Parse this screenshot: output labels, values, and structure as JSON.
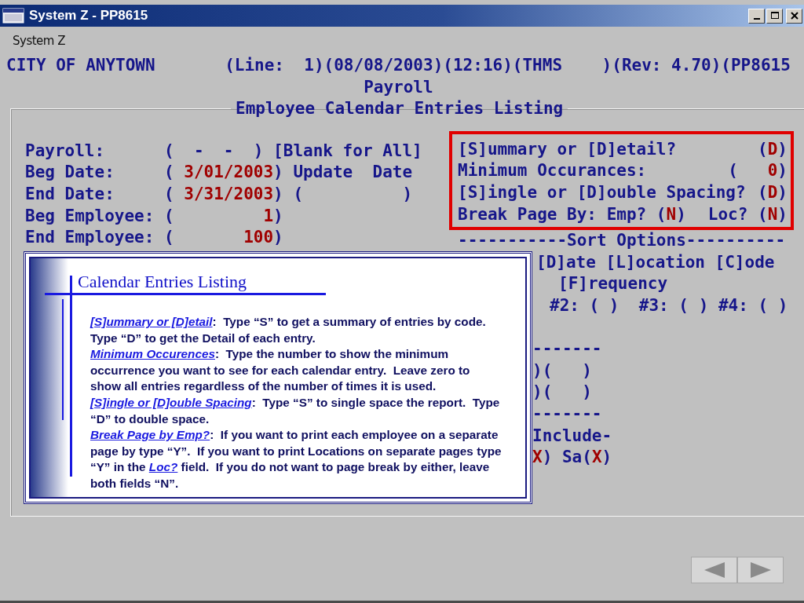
{
  "window": {
    "title": "System Z - PP8615"
  },
  "menu": [
    {
      "label": "System Z"
    }
  ],
  "header": {
    "org": "CITY OF ANYTOWN",
    "session": "(Line:  1)(08/08/2003)(12:16)(THMS    )(Rev: 4.70)(PP8615",
    "module": "Payroll"
  },
  "group": {
    "title": "Employee Calendar Entries Listing",
    "left_fields": [
      {
        "label": "Payroll:",
        "field": {
          "open": "(",
          "close": ")",
          "value": "-  -",
          "kind": "mask"
        },
        "note": {
          "kind": "text",
          "text": "[Blank for All]"
        }
      },
      {
        "label": "Beg Date:",
        "field": {
          "open": "(",
          "close": ")",
          "value": "3/01/2003",
          "kind": "value"
        },
        "note": {
          "kind": "text",
          "text": "Update  Date"
        }
      },
      {
        "label": "End Date:",
        "field": {
          "open": "(",
          "close": ")",
          "value": "3/31/2003",
          "kind": "value"
        },
        "note": {
          "kind": "field",
          "open": "(",
          "close": ")"
        }
      },
      {
        "label": "Beg Employee:",
        "field": {
          "open": "(",
          "close": ")",
          "value": "1",
          "kind": "value"
        }
      },
      {
        "label": "End Employee:",
        "field": {
          "open": "(",
          "close": ")",
          "value": "100",
          "kind": "value"
        }
      }
    ],
    "options": [
      {
        "label": "[S]ummary or [D]etail?",
        "field": {
          "open": "(",
          "close": ")",
          "value": "D",
          "kind": "value"
        }
      },
      {
        "label": "Minimum Occurances:",
        "field": {
          "open": "(",
          "close": ")",
          "value": "0",
          "kind": "number"
        }
      },
      {
        "label": "[S]ingle or [D]ouble Spacing?",
        "field": {
          "open": "(",
          "close": ")",
          "value": "D",
          "kind": "value"
        }
      },
      {
        "label": "Break Page By: Emp?",
        "field": {
          "open": "(",
          "close": ")",
          "value": "N",
          "kind": "value"
        },
        "label2": "Loc?",
        "field2": {
          "open": "(",
          "close": ")",
          "value": "N",
          "kind": "value"
        }
      }
    ],
    "sort": {
      "title": "-----------Sort Options----------",
      "lines": [
        {
          "kind": "choices",
          "text": "[D]ate [L]ocation [C]ode"
        },
        {
          "kind": "continued",
          "text": "[F]requency"
        },
        {
          "kind": "keys",
          "text": "#2: ( )  #3: ( ) #4: ( )"
        }
      ]
    },
    "fragments": [
      {
        "parts": [
          {
            "text": "-------",
            "kind": "label"
          }
        ]
      },
      {
        "parts": [
          {
            "text": ")(   )",
            "kind": "label"
          }
        ]
      },
      {
        "parts": [
          {
            "text": ")(   )",
            "kind": "label"
          }
        ]
      },
      {
        "parts": [
          {
            "text": "-------",
            "kind": "label"
          }
        ]
      },
      {
        "parts": [
          {
            "text": "Include-",
            "kind": "label"
          }
        ]
      },
      {
        "parts": [
          {
            "text": "X",
            "kind": "value"
          },
          {
            "text": ") Sa(",
            "kind": "label"
          },
          {
            "text": "X",
            "kind": "value"
          },
          {
            "text": ")",
            "kind": "label"
          }
        ]
      }
    ]
  },
  "callout": {
    "title": "Calendar Entries Listing",
    "paragraphs": [
      {
        "parts": [
          {
            "text": "[S]ummary or [D]etail",
            "kind": "link"
          },
          {
            "text": ":  Type “S” to get a summary of entries by code.  Type “D” to get the Detail of each entry.",
            "kind": "plain"
          }
        ]
      },
      {
        "parts": [
          {
            "text": "Minimum Occurences",
            "kind": "link"
          },
          {
            "text": ":  Type the number to show the minimum occurrence you want to see for each calendar entry.  Leave zero to show all entries regardless of the number of times it is used.",
            "kind": "plain"
          }
        ]
      },
      {
        "parts": [
          {
            "text": "[S]ingle or [D]ouble Spacing",
            "kind": "link"
          },
          {
            "text": ":  Type “S” to single space the report.  Type “D” to double space.",
            "kind": "plain"
          }
        ]
      },
      {
        "parts": [
          {
            "text": "Break Page by Emp?",
            "kind": "link"
          },
          {
            "text": ":  If you want to print each employee on a separate page by type “Y”.  If you want to print Locations on separate pages type “Y” in the ",
            "kind": "plain"
          },
          {
            "text": "Loc?",
            "kind": "link"
          },
          {
            "text": " field.  If you do not want to page break by either, leave both fields “N”.",
            "kind": "plain"
          }
        ]
      }
    ]
  },
  "nav": [
    {
      "kind": "prev"
    },
    {
      "kind": "next"
    }
  ]
}
